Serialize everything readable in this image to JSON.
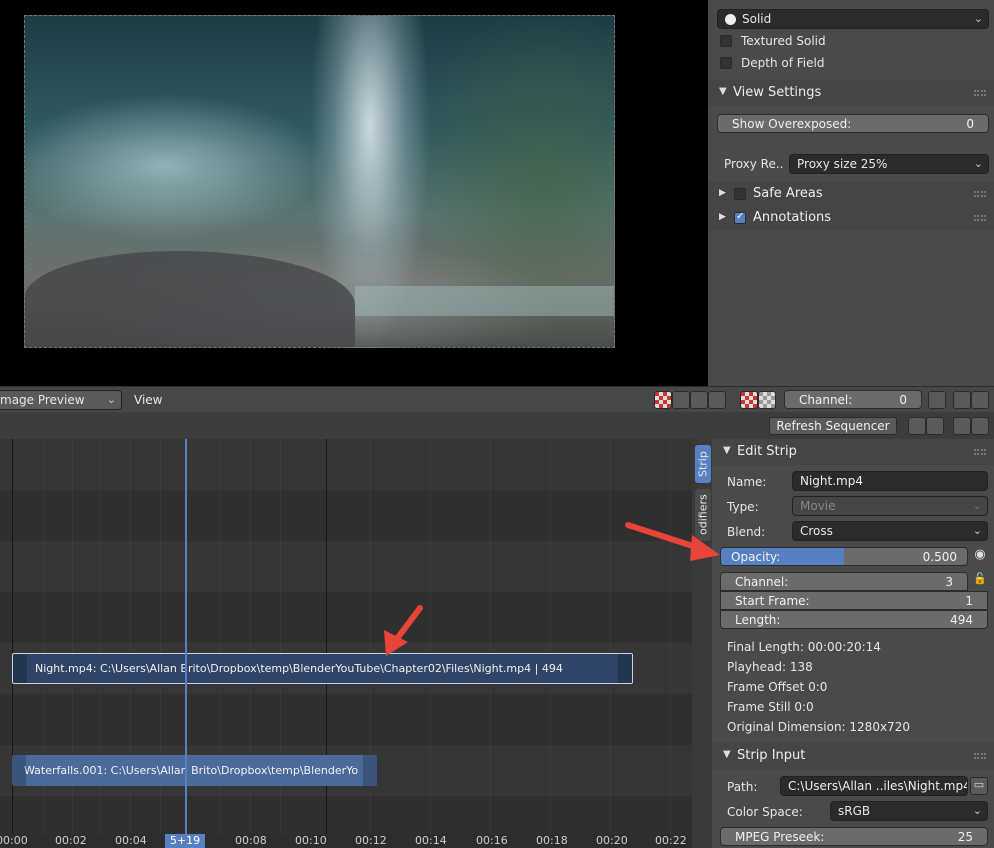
{
  "preview": {
    "display_mode": "Solid",
    "textured_solid": "Textured Solid",
    "depth_of_field": "Depth of Field",
    "view_settings_title": "View Settings",
    "show_overexposed_label": "Show Overexposed:",
    "show_overexposed_value": "0",
    "proxy_label": "Proxy Re..",
    "proxy_value": "Proxy size 25%",
    "safe_areas": "Safe Areas",
    "annotations": "Annotations"
  },
  "header": {
    "view_mode": "mage Preview",
    "view_menu": "View",
    "channel_label": "Channel:",
    "channel_value": "0"
  },
  "toolbar": {
    "refresh": "Refresh Sequencer"
  },
  "tabs": {
    "strip": "Strip",
    "modifiers": "odifiers"
  },
  "edit_strip": {
    "title": "Edit Strip",
    "name_label": "Name:",
    "name_value": "Night.mp4",
    "type_label": "Type:",
    "type_value": "Movie",
    "blend_label": "Blend:",
    "blend_value": "Cross",
    "opacity_label": "Opacity:",
    "opacity_value": "0.500",
    "opacity_fraction": 0.5,
    "channel_label": "Channel:",
    "channel_value": "3",
    "start_frame_label": "Start Frame:",
    "start_frame_value": "1",
    "length_label": "Length:",
    "length_value": "494",
    "final_length": "Final Length: 00:00:20:14",
    "playhead": "Playhead: 138",
    "frame_offset": "Frame Offset 0:0",
    "frame_still": "Frame Still 0:0",
    "original_dimension": "Original Dimension: 1280x720"
  },
  "strip_input": {
    "title": "Strip Input",
    "path_label": "Path:",
    "path_value": "C:\\Users\\Allan ..iles\\Night.mp4",
    "color_space_label": "Color Space:",
    "color_space_value": "sRGB",
    "mpeg_preseek_label": "MPEG Preseek:",
    "mpeg_preseek_value": "25"
  },
  "timeline": {
    "strip_night": "Night.mp4: C:\\Users\\Allan Brito\\Dropbox\\temp\\BlenderYouTube\\Chapter02\\Files\\Night.mp4 | 494",
    "strip_waterfalls": "Waterfalls.001: C:\\Users\\Allan Brito\\Dropbox\\temp\\BlenderYo",
    "current_frame": "5+19",
    "ticks": [
      "00:00",
      "00:02",
      "00:04",
      "00:08",
      "00:10",
      "00:12",
      "00:14",
      "00:16",
      "00:18",
      "00:20",
      "00:22"
    ]
  },
  "colors": {
    "accent": "#5680c2",
    "arrow": "#e8443a",
    "strip_night": "#2f4466",
    "strip_waterfalls": "#4a6a9a"
  }
}
